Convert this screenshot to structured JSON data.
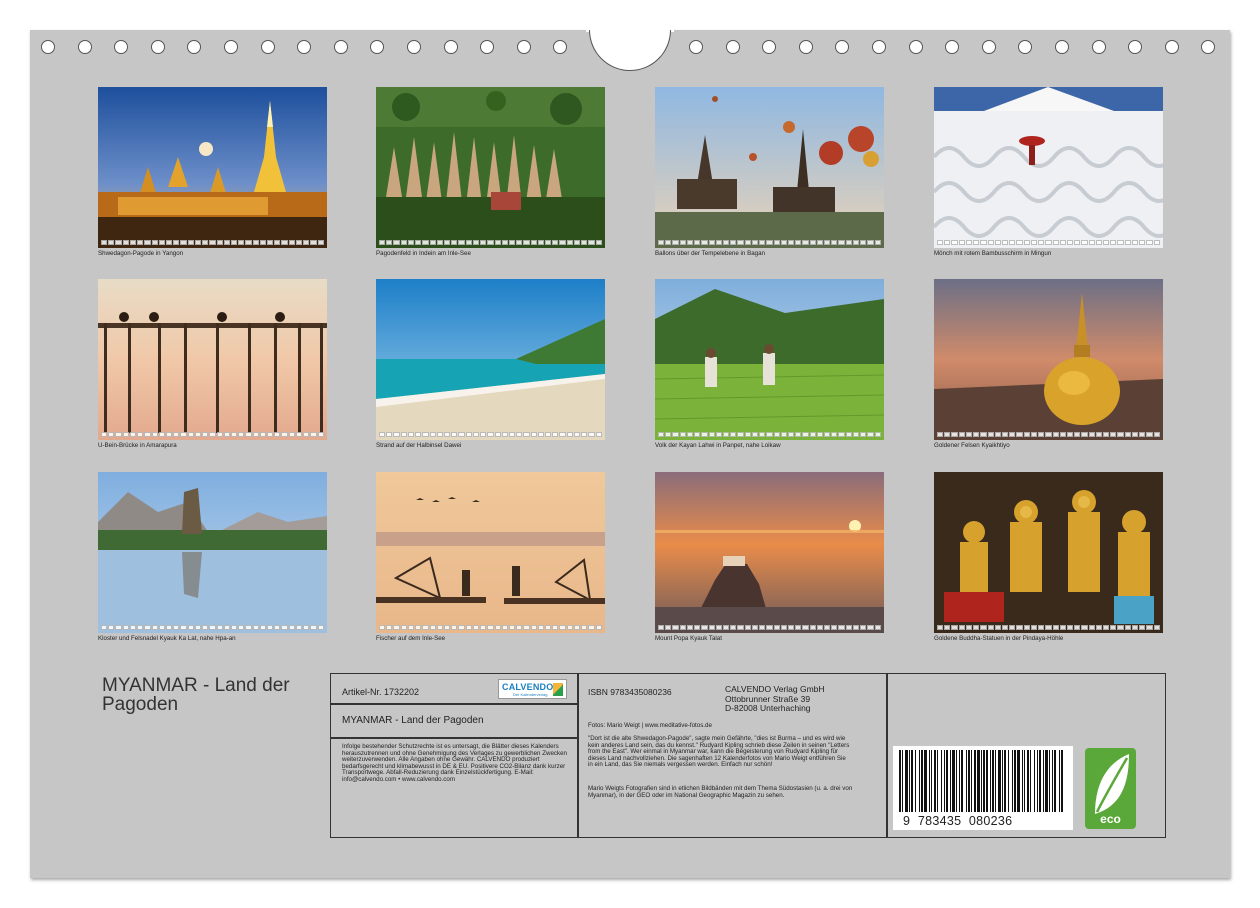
{
  "photos": [
    {
      "caption": "Shwedagon-Pagode in Yangon",
      "scene": "shwedagon-pagoda"
    },
    {
      "caption": "Pagodenfeld in Indein am Inle-See",
      "scene": "indein-pagoda-field"
    },
    {
      "caption": "Ballons über der Tempelebene in Bagan",
      "scene": "bagan-balloons"
    },
    {
      "caption": "Mönch mit rotem Bambusschirm in Mingun",
      "scene": "mingun-monk"
    },
    {
      "caption": "U-Bein-Brücke in Amarapura",
      "scene": "u-bein-bridge"
    },
    {
      "caption": "Strand auf der Halbinsel Dawei",
      "scene": "dawei-beach"
    },
    {
      "caption": "Volk der Kayan Lahwi in Panpet, nahe Loikaw",
      "scene": "kayan-rice-field"
    },
    {
      "caption": "Goldener Felsen Kyaikhtiyo",
      "scene": "golden-rock"
    },
    {
      "caption": "Kloster und Felsnadel Kyauk Ka Lat, nahe Hpa-an",
      "scene": "kyauk-ka-lat"
    },
    {
      "caption": "Fischer auf dem Inle-See",
      "scene": "inle-fishermen"
    },
    {
      "caption": "Mount Popa Kyauk Talat",
      "scene": "mount-popa-sunset"
    },
    {
      "caption": "Goldene Buddha-Statuen in der Pindaya-Höhle",
      "scene": "pindaya-buddhas"
    }
  ],
  "calendar_title": "MYANMAR - Land der Pagoden",
  "info": {
    "article_no": "Artikel-Nr. 1732202",
    "logo_text": "CALVENDO",
    "logo_sub": "Der Kalenderverlag",
    "product_title": "MYANMAR - Land der Pagoden",
    "legal_text": "Infolge bestehender Schutzrechte ist es untersagt, die Blätter dieses Kalenders herauszutrennen und ohne Genehmigung des Verlages zu gewerblichen Zwecken weiterzuverwenden. Alle Angaben ohne Gewähr. CALVENDO produziert bedarfsgerecht und klimabewusst in DE & EU. Positivere CO2-Bilanz dank kurzer Transportwege. Abfall-Reduzierung dank Einzelstückfertigung. E-Mail: info@calvendo.com • www.calvendo.com",
    "isbn": "ISBN 9783435080236",
    "publisher": [
      "CALVENDO Verlag GmbH",
      "Ottobrunner Straße 39",
      "D-82008 Unterhaching"
    ],
    "photo_credit": "Fotos: Mario Weigt | www.meditative-fotos.de",
    "description": "\"Dort ist die alte Shwedagon-Pagode\", sagte mein Gefährte, \"dies ist Burma – und es wird wie kein anderes Land sein, das du kennst.\" Rudyard Kipling schrieb diese Zeilen in seinen \"Letters from the East\". Wer einmal in Myanmar war, kann die Begeisterung von Rudyard Kipling für dieses Land nachvollziehen. Die sagenhaften 12 Kalenderfotos von Mario Weigt entführen Sie in ein Land, das Sie niemals vergessen werden. Einfach nur schön!",
    "author_bio": "Mario Weigts Fotografien sind in etlichen Bildbänden mit dem Thema Südostasien (u. a. drei von Myanmar), in der GEO oder im National Geographic Magazin zu sehen.",
    "barcode_digits": [
      "9",
      "783435",
      "080236"
    ],
    "eco_label": "eco"
  },
  "colors": {
    "sheet": "#c6c6c6",
    "eco_green": "#5aa83a",
    "calvendo_blue": "#1a7fc1"
  }
}
